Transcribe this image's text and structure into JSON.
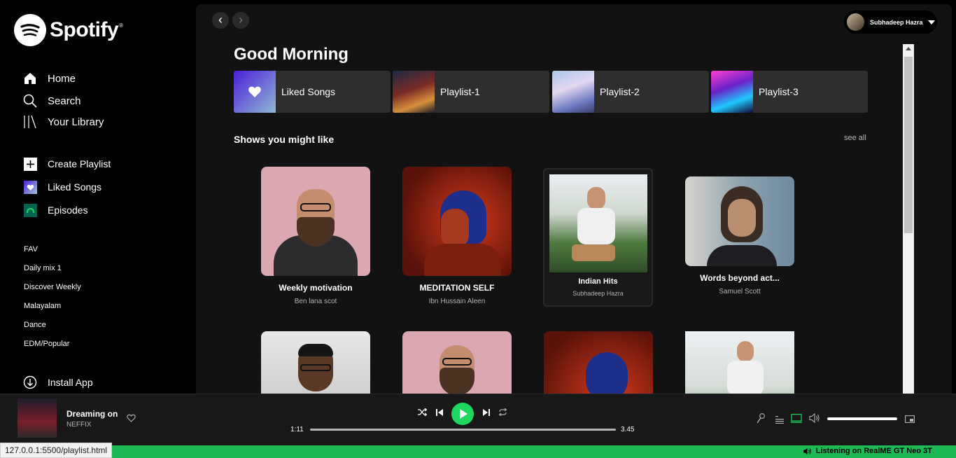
{
  "sidebar": {
    "logo_text": "Spotify",
    "nav": [
      {
        "label": "Home",
        "icon": "home-icon"
      },
      {
        "label": "Search",
        "icon": "search-icon"
      },
      {
        "label": "Your Library",
        "icon": "library-icon"
      }
    ],
    "actions": [
      {
        "label": "Create Playlist",
        "icon": "plus-icon"
      },
      {
        "label": "Liked Songs",
        "icon": "heart-icon"
      },
      {
        "label": "Episodes",
        "icon": "episodes-icon"
      }
    ],
    "playlists": [
      "FAV",
      "Daily mix 1",
      "Discover Weekly",
      "Malayalam",
      "Dance",
      "EDM/Popular"
    ],
    "install_label": "Install App"
  },
  "header": {
    "back": "‹",
    "forward": "›",
    "user_name": "Subhadeep Hazra"
  },
  "main": {
    "greeting": "Good Morning",
    "quick_links": [
      {
        "label": "Liked Songs"
      },
      {
        "label": "Playlist-1"
      },
      {
        "label": "Playlist-2"
      },
      {
        "label": "Playlist-3"
      }
    ],
    "section_title": "Shows you might like",
    "see_all": "see all",
    "cards": [
      {
        "title": "Weekly motivation",
        "subtitle": "Ben lana scot"
      },
      {
        "title": "MEDITATION SELF",
        "subtitle": "Ibn Hussain Aleen"
      },
      {
        "title": "Indian Hits",
        "subtitle": "Subhadeep Hazra"
      },
      {
        "title": "Words beyond act...",
        "subtitle": "Samuel Scott"
      }
    ]
  },
  "player": {
    "track_title": "Dreaming on",
    "track_artist": "NEFFIX",
    "elapsed": "1:11",
    "duration": "3.45",
    "progress_fraction": 0.0
  },
  "status": {
    "url": "127.0.0.1:5500/playlist.html",
    "listening": "Listening on RealME GT Neo 3T"
  },
  "colors": {
    "accent": "#1ed760",
    "status_bar": "#1db954"
  }
}
